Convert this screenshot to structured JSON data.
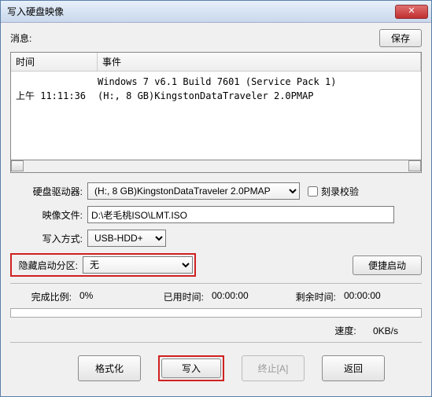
{
  "window": {
    "title": "写入硬盘映像"
  },
  "top": {
    "info_label": "消息:",
    "save_btn": "保存"
  },
  "log": {
    "col_time": "时间",
    "col_event": "事件",
    "rows": [
      {
        "time": "",
        "event": "Windows 7 v6.1 Build 7601 (Service Pack 1)"
      },
      {
        "time": "上午 11:11:36",
        "event": "(H:, 8 GB)KingstonDataTraveler 2.0PMAP"
      }
    ]
  },
  "form": {
    "drive_label": "硬盘驱动器:",
    "drive_value": "(H:, 8 GB)KingstonDataTraveler 2.0PMAP",
    "verify_label": "刻录校验",
    "image_label": "映像文件:",
    "image_value": "D:\\老毛桃ISO\\LMT.ISO",
    "mode_label": "写入方式:",
    "mode_value": "USB-HDD+",
    "hidden_label": "隐藏启动分区:",
    "hidden_value": "无",
    "convenient_boot": "便捷启动"
  },
  "status": {
    "progress_label": "完成比例:",
    "progress_value": "0%",
    "elapsed_label": "已用时间:",
    "elapsed_value": "00:00:00",
    "remain_label": "剩余时间:",
    "remain_value": "00:00:00",
    "speed_label": "速度:",
    "speed_value": "0KB/s"
  },
  "buttons": {
    "format": "格式化",
    "write": "写入",
    "abort": "终止[A]",
    "back": "返回"
  },
  "close_glyph": "✕"
}
